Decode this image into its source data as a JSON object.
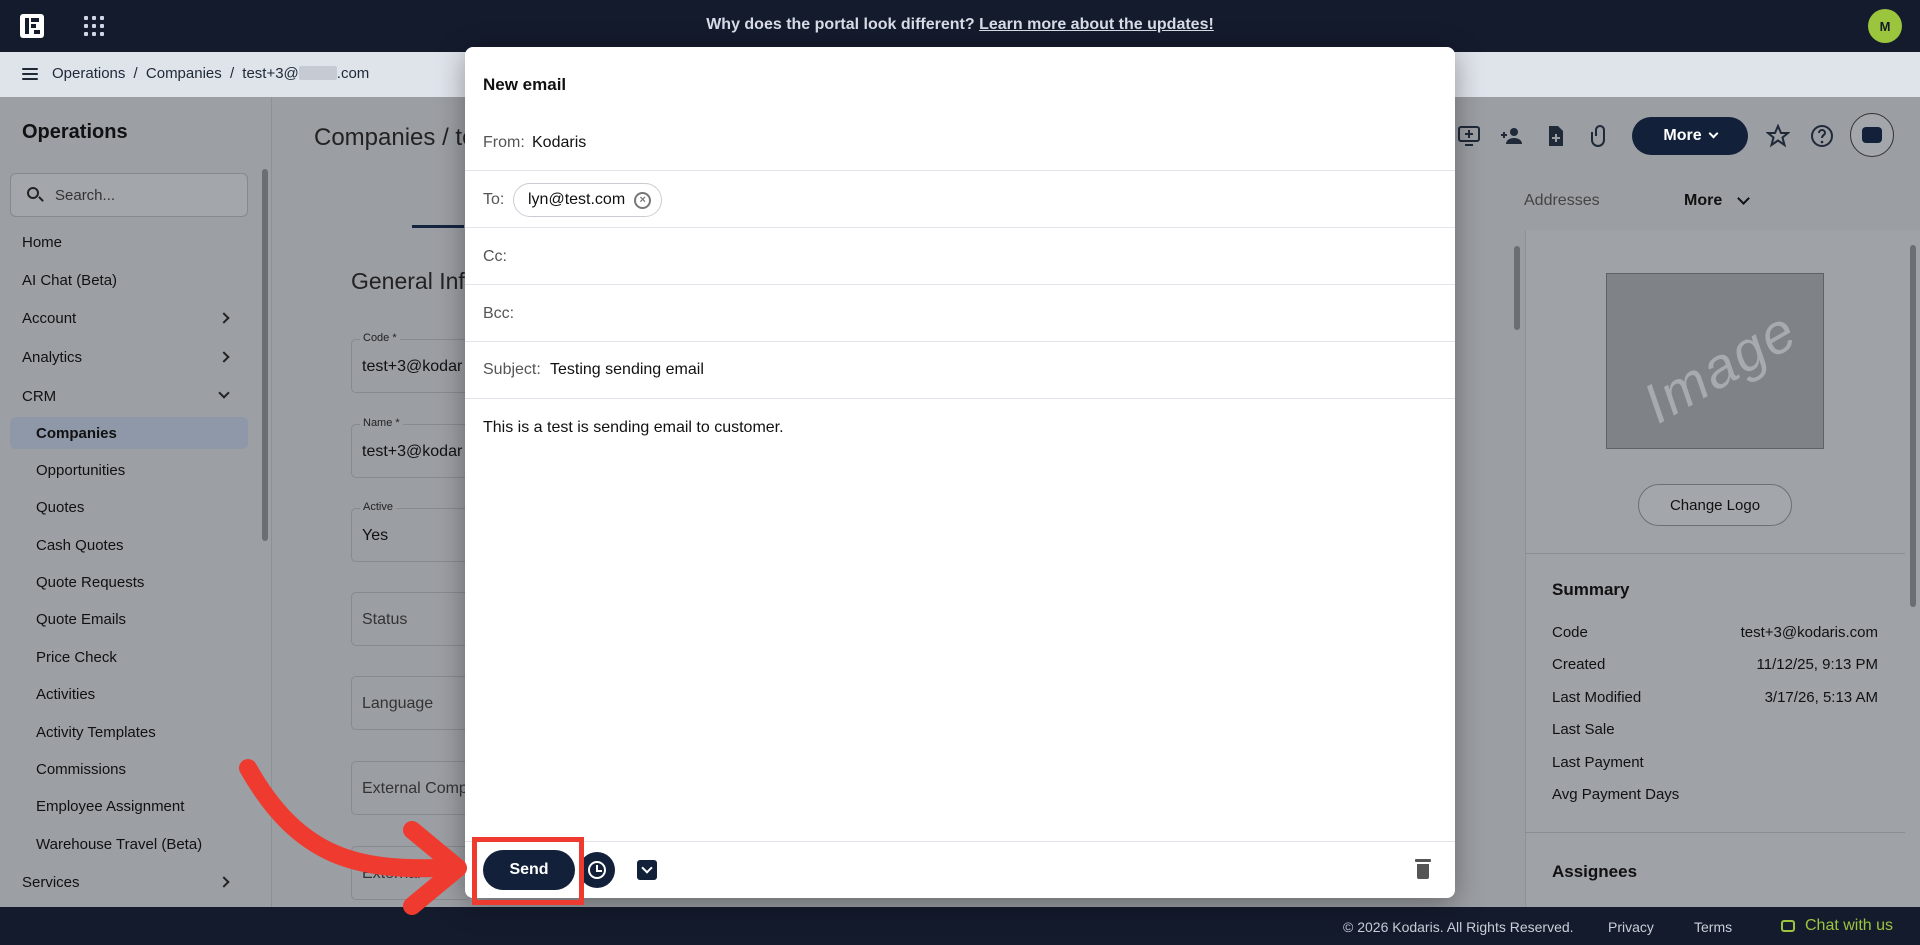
{
  "topbar": {
    "announcement": "Why does the portal look different?",
    "announcement_link": "Learn more about the updates!",
    "avatar_initial": "M"
  },
  "breadcrumb": {
    "items": [
      "Operations",
      "/",
      "Companies",
      "/",
      "test+3@",
      ".com"
    ]
  },
  "sidebar": {
    "title": "Operations",
    "search_placeholder": "Search...",
    "items": [
      "Home",
      "AI Chat (Beta)",
      "Account",
      "Analytics",
      "CRM",
      "Services"
    ],
    "crm_items": [
      "Companies",
      "Opportunities",
      "Quotes",
      "Cash Quotes",
      "Quote Requests",
      "Quote Emails",
      "Price Check",
      "Activities",
      "Activity Templates",
      "Commissions",
      "Employee Assignment",
      "Warehouse Travel (Beta)"
    ]
  },
  "main": {
    "heading": "Companies / te",
    "tabs": {
      "addresses": "Addresses",
      "more": "More"
    },
    "more_button": "More",
    "section_title": "General Inf",
    "fields": [
      {
        "label": "Code *",
        "value": "test+3@kodar"
      },
      {
        "label": "Name *",
        "value": "test+3@kodar"
      },
      {
        "label": "Active",
        "value": "Yes"
      },
      {
        "label": "",
        "value": "Status"
      },
      {
        "label": "",
        "value": "Language"
      },
      {
        "label": "",
        "value": "External Comp"
      },
      {
        "label": "",
        "value": "External"
      }
    ]
  },
  "right_panel": {
    "image_placeholder": "Image",
    "change_logo": "Change Logo",
    "summary_title": "Summary",
    "summary": [
      {
        "label": "Code",
        "value": "test+3@kodaris.com"
      },
      {
        "label": "Created",
        "value": "11/12/25, 9:13 PM"
      },
      {
        "label": "Last Modified",
        "value": "3/17/26, 5:13 AM"
      },
      {
        "label": "Last Sale",
        "value": ""
      },
      {
        "label": "Last Payment",
        "value": ""
      },
      {
        "label": "Avg Payment Days",
        "value": ""
      }
    ],
    "assignees_title": "Assignees"
  },
  "modal": {
    "title": "New email",
    "from_label": "From:",
    "from_value": "Kodaris",
    "to_label": "To:",
    "to_chip": "lyn@test.com",
    "cc_label": "Cc:",
    "bcc_label": "Bcc:",
    "subject_label": "Subject:",
    "subject_value": "Testing sending email",
    "body": "This is a test is sending email to customer.",
    "send_label": "Send"
  },
  "footer": {
    "copyright": "© 2026 Kodaris. All Rights Reserved.",
    "privacy": "Privacy",
    "terms": "Terms",
    "chat": "Chat with us"
  },
  "colors": {
    "navy": "#12203a",
    "topbar": "#141b2d",
    "accent_green": "#9bc53d",
    "annotation_red": "#ef3b2f"
  }
}
